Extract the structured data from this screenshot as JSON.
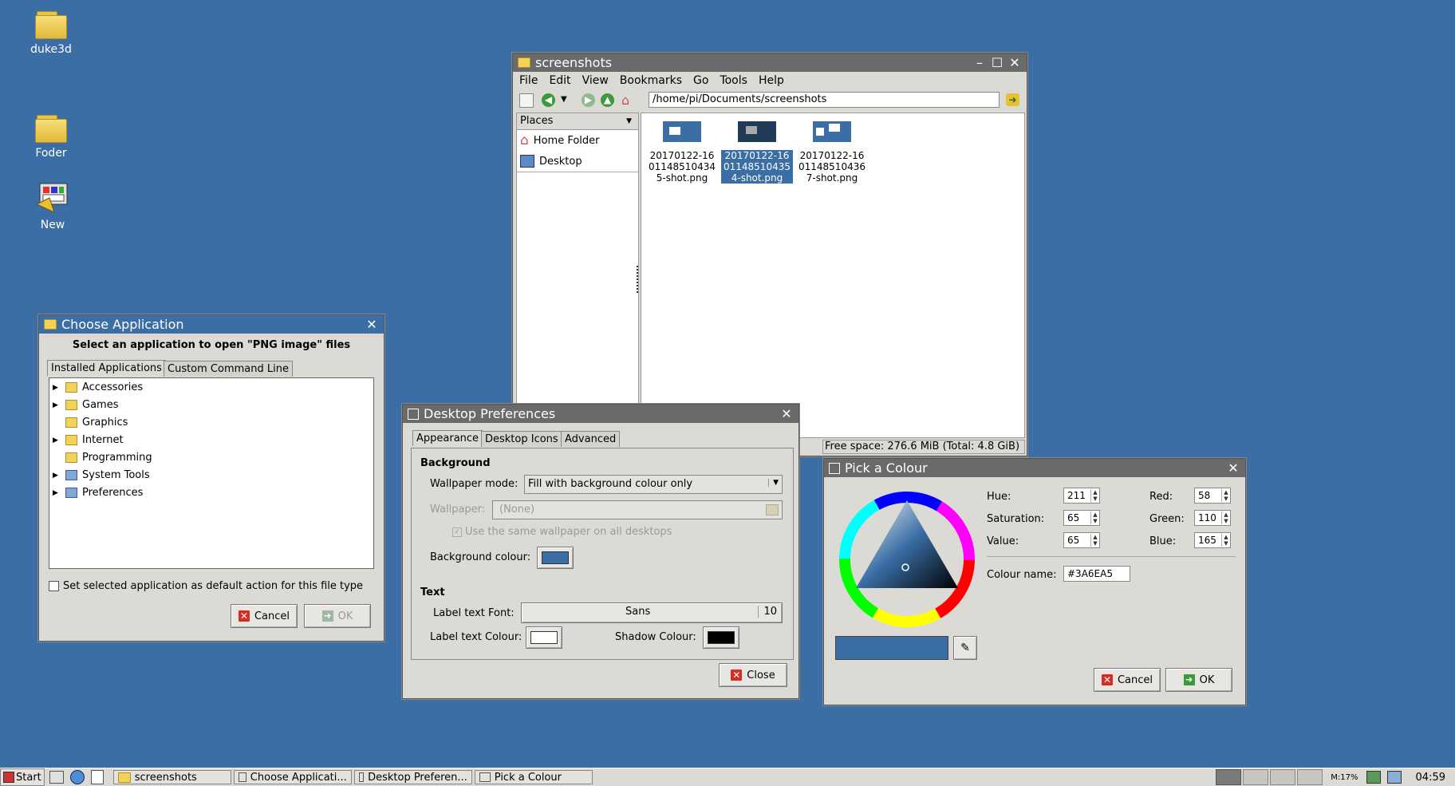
{
  "desktop": {
    "icons": [
      {
        "label": "duke3d"
      },
      {
        "label": "Foder"
      },
      {
        "label": "New"
      }
    ]
  },
  "filemanager": {
    "title": "screenshots",
    "menu": [
      "File",
      "Edit",
      "View",
      "Bookmarks",
      "Go",
      "Tools",
      "Help"
    ],
    "path": "/home/pi/Documents/screenshots",
    "places_label": "Places",
    "places": [
      "Home Folder",
      "Desktop"
    ],
    "files": [
      {
        "line1": "20170122-16",
        "line2": "01148510434",
        "line3": "5-shot.png",
        "selected": false
      },
      {
        "line1": "20170122-16",
        "line2": "01148510435",
        "line3": "4-shot.png",
        "selected": true
      },
      {
        "line1": "20170122-16",
        "line2": "01148510436",
        "line3": "7-shot.png",
        "selected": false
      }
    ],
    "status": "Free space: 276.6 MiB (Total: 4.8 GiB)"
  },
  "chooseapp": {
    "title": "Choose Application",
    "heading": "Select an application to open \"PNG image\" files",
    "tabs": [
      "Installed Applications",
      "Custom Command Line"
    ],
    "tree": [
      {
        "label": "Accessories",
        "expander": true
      },
      {
        "label": "Games",
        "expander": true
      },
      {
        "label": "Graphics",
        "expander": false
      },
      {
        "label": "Internet",
        "expander": true
      },
      {
        "label": "Programming",
        "expander": false
      },
      {
        "label": "System Tools",
        "expander": true
      },
      {
        "label": "Preferences",
        "expander": true
      }
    ],
    "default_checkbox": "Set selected application as default action for this file type",
    "cancel": "Cancel",
    "ok": "OK"
  },
  "deskprefs": {
    "title": "Desktop Preferences",
    "tabs": [
      "Appearance",
      "Desktop Icons",
      "Advanced"
    ],
    "background_heading": "Background",
    "wallpaper_mode_label": "Wallpaper mode:",
    "wallpaper_mode_value": "Fill with background colour only",
    "wallpaper_label": "Wallpaper:",
    "wallpaper_value": "(None)",
    "same_wallpaper": "Use the same wallpaper on all desktops",
    "bg_colour_label": "Background colour:",
    "bg_colour": "#3A6EA5",
    "text_heading": "Text",
    "label_font_label": "Label text Font:",
    "label_font_name": "Sans",
    "label_font_size": "10",
    "label_colour_label": "Label text Colour:",
    "shadow_colour_label": "Shadow Colour:",
    "close": "Close"
  },
  "colourpicker": {
    "title": "Pick a Colour",
    "hue_label": "Hue:",
    "hue": "211",
    "sat_label": "Saturation:",
    "sat": "65",
    "val_label": "Value:",
    "val": "65",
    "red_label": "Red:",
    "red": "58",
    "green_label": "Green:",
    "green": "110",
    "blue_label": "Blue:",
    "blue": "165",
    "name_label": "Colour name:",
    "name": "#3A6EA5",
    "cancel": "Cancel",
    "ok": "OK"
  },
  "taskbar": {
    "start": "Start",
    "tasks": [
      "screenshots",
      "Choose Applicati...",
      "Desktop Preferen...",
      "Pick a Colour"
    ],
    "mem": "M:17%",
    "clock": "04:59"
  }
}
